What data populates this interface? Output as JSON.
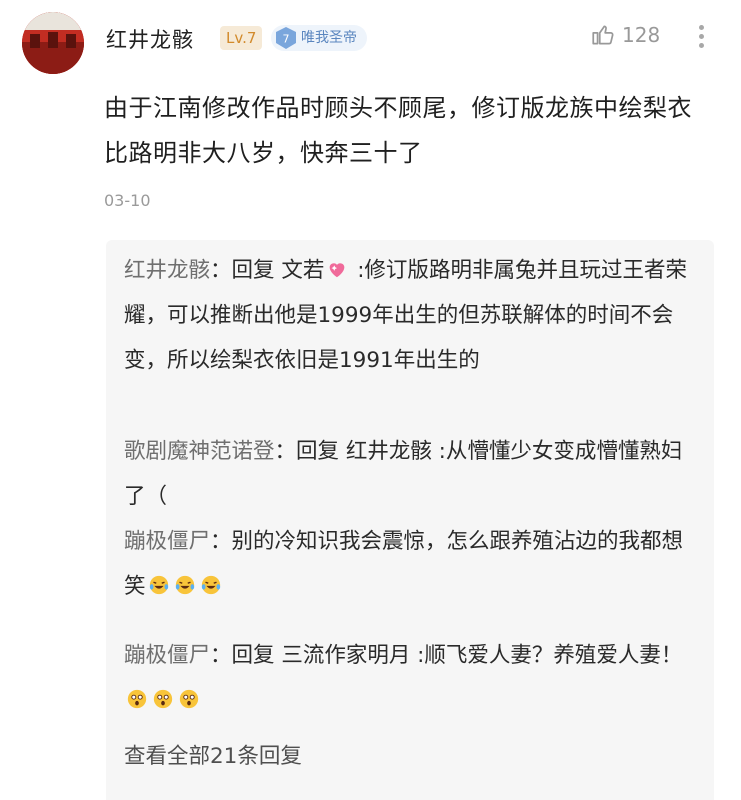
{
  "comment": {
    "user": {
      "name": "红井龙骸",
      "level": "Lv.7",
      "vip_level": "7",
      "vip_title": "唯我圣帝"
    },
    "likes": "128",
    "text": "由于江南修改作品时顾头不顾尾，修订版龙族中绘梨衣比路明非大八岁，快奔三十了",
    "date": "03-10"
  },
  "replies": [
    {
      "author": "红井龙骸",
      "pre": "：回复 文若",
      "emoji": "heart-sparkle",
      "post": " :修订版路明非属兔并且玩过王者荣耀，可以推断出他是1999年出生的但苏联解体的时间不会变，所以绘梨衣依旧是1991年出生的"
    },
    {
      "author": "歌剧魔神范诺登",
      "text": "：回复 红井龙骸 :从懵懂少女变成懵懂熟妇了（"
    },
    {
      "author": "蹦极僵尸",
      "text": "：别的冷知识我会震惊，怎么跟养殖沾边的我都想笑"
    },
    {
      "author": "蹦极僵尸",
      "text": "：回复 三流作家明月 :顺飞爱人妻？养殖爱人妻！"
    }
  ],
  "view_all": "查看全部21条回复",
  "colors": {
    "accent_red": "#b5261e",
    "level_gold": "#d28a2b",
    "vip_blue": "#5a86bf",
    "reply_bg": "#f6f6f6"
  },
  "icons": [
    "avatar-image",
    "vip-gem-icon",
    "thumbs-up-icon",
    "more-vertical-icon",
    "heart-sparkle-emoji",
    "laugh-cry-emoji",
    "astonished-emoji"
  ]
}
